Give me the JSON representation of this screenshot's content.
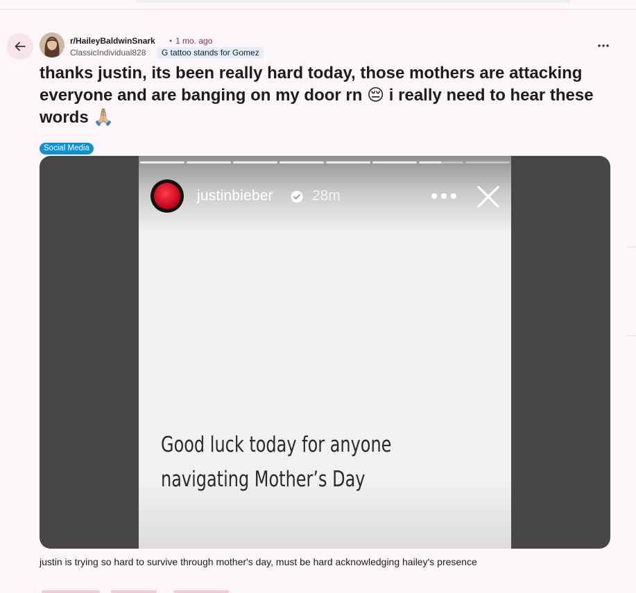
{
  "post": {
    "subreddit": "r/HaileyBaldwinSnark",
    "separator": "•",
    "time": "1 mo. ago",
    "username": "ClassicIndividual828",
    "user_flair": "G tattoo stands for Gomez",
    "title_text": "thanks justin, its been really hard today, those mothers are attacking everyone and are banging on my door rn",
    "title_emoji_1": "😔",
    "title_text_2": "i really need to hear these words",
    "title_emoji_2": "🙏🏼",
    "post_flair": "Social Media",
    "caption": "justin is trying so hard to survive through mother's day, must be hard acknowledging hailey's presence"
  },
  "story": {
    "username": "justinbieber",
    "time": "28m",
    "text": "Good luck today for anyone navigating Mother’s Day",
    "progress_segments": [
      1,
      1,
      1,
      1,
      1,
      1,
      0.5,
      0
    ]
  },
  "icons": {
    "back": "arrow-left-icon",
    "more": "more-horizontal-icon",
    "verified": "verified-badge-icon",
    "story_more": "more-horizontal-icon",
    "close": "close-icon"
  },
  "colors": {
    "flair_tag": "#0a91d6",
    "subreddit_time": "#8a2a55",
    "user_flair_bg": "#e4edf8"
  }
}
